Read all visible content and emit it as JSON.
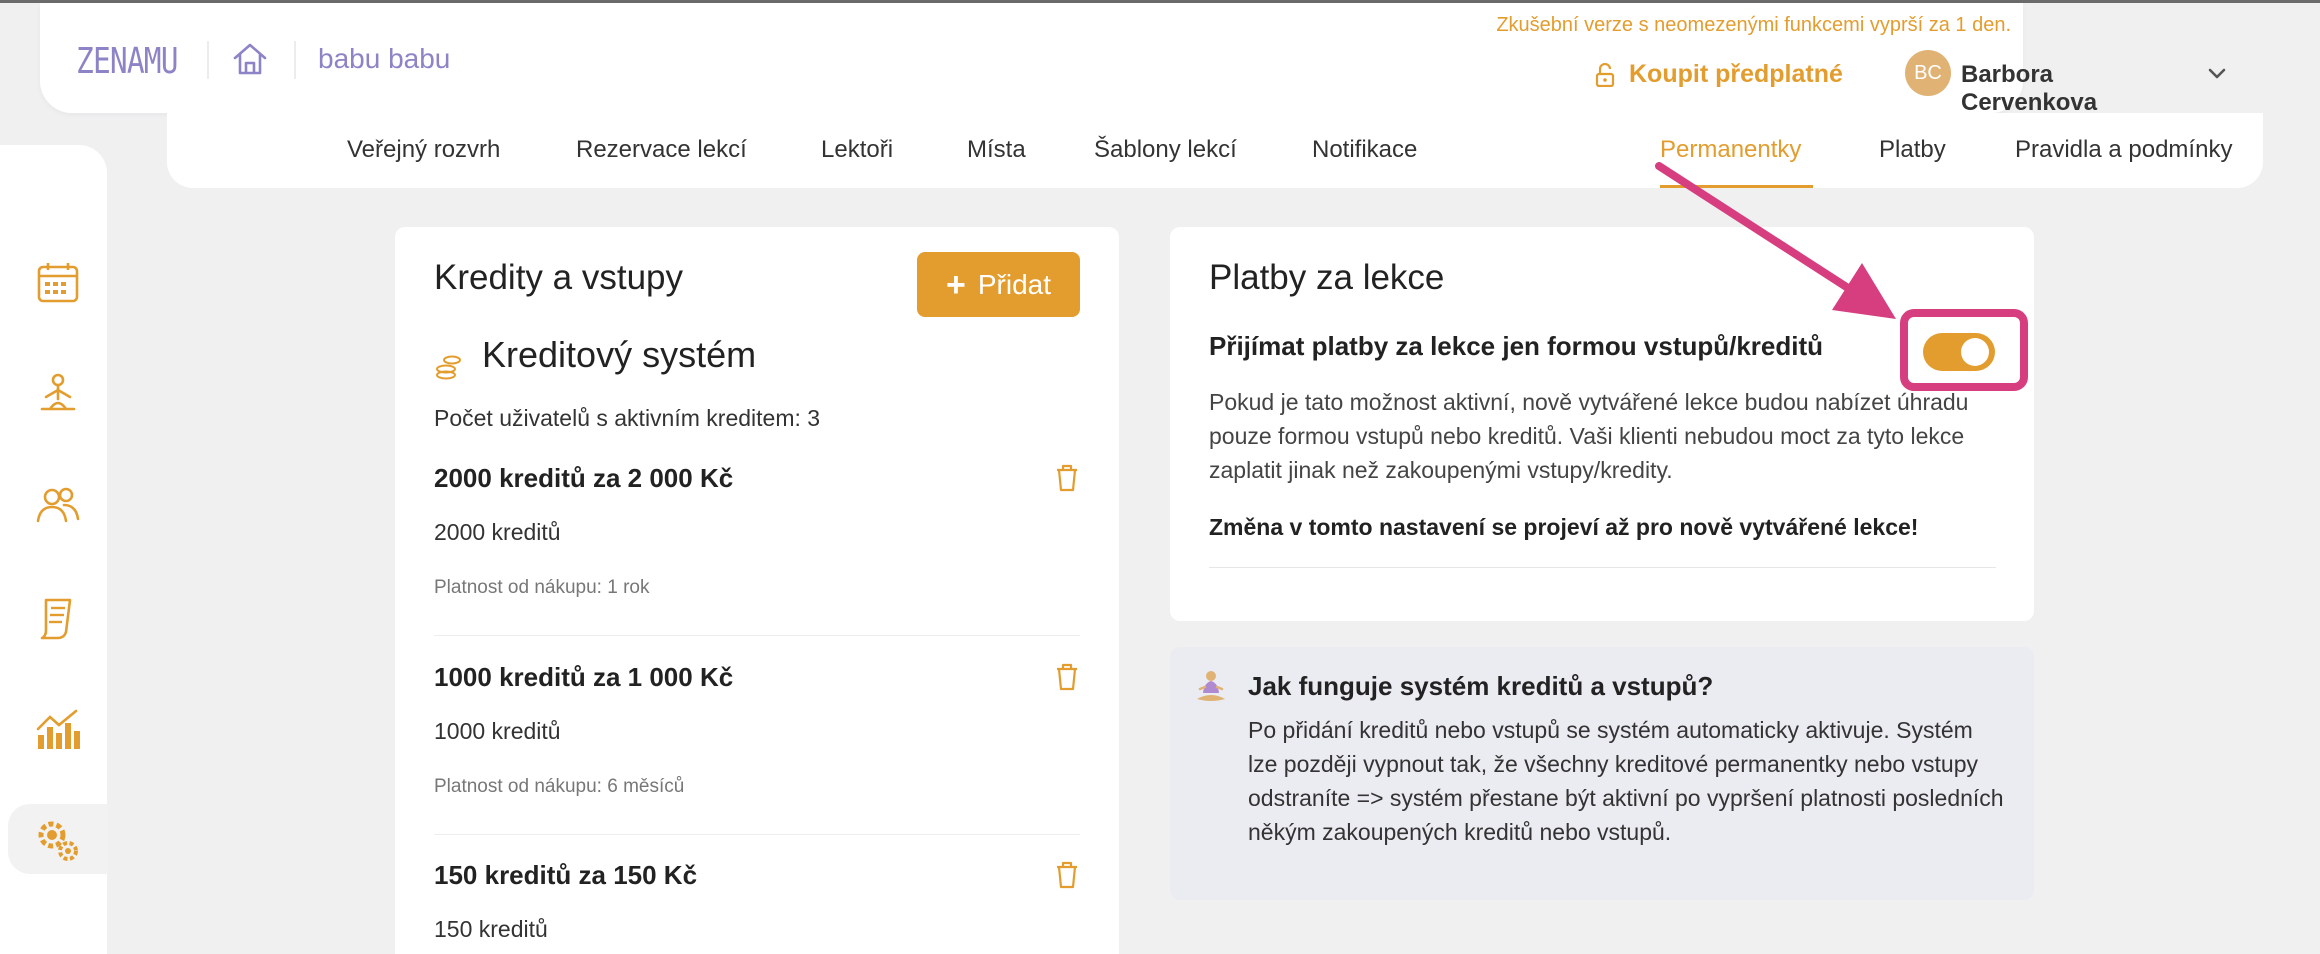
{
  "header": {
    "logo": "ZENAMU",
    "workspace_name": "babu babu",
    "trial_notice": "Zkušební verze s neomezenými funkcemi vyprší za 1 den.",
    "buy_label": "Koupit předplatné",
    "user_initials": "BC",
    "user_name": "Barbora Cervenkova"
  },
  "nav": {
    "items": [
      {
        "label": "Veřejný rozvrh"
      },
      {
        "label": "Rezervace lekcí"
      },
      {
        "label": "Lektoři"
      },
      {
        "label": "Místa"
      },
      {
        "label": "Šablony lekcí"
      },
      {
        "label": "Notifikace"
      },
      {
        "label": "Permanentky"
      },
      {
        "label": "Platby"
      },
      {
        "label": "Pravidla a podmínky"
      }
    ],
    "active": "Permanentky"
  },
  "sidebar": {
    "icons": [
      "calendar-icon",
      "yoga-icon",
      "users-icon",
      "document-icon",
      "chart-icon",
      "settings-icon"
    ],
    "active": "settings-icon"
  },
  "credits": {
    "title": "Kredity a vstupy",
    "add_label": "Přidat",
    "system_title": "Kreditový systém",
    "active_users_text": "Počet uživatelů s aktivním kreditem: 3",
    "items": [
      {
        "title": "2000 kreditů za 2 000 Kč",
        "credits": "2000 kreditů",
        "validity": "Platnost od nákupu: 1 rok"
      },
      {
        "title": "1000 kreditů za 1 000 Kč",
        "credits": "1000 kreditů",
        "validity": "Platnost od nákupu: 6 měsíců"
      },
      {
        "title": "150 kreditů za 150 Kč",
        "credits": "150 kreditů",
        "validity": ""
      }
    ]
  },
  "payments": {
    "title": "Platby za lekce",
    "toggle_label": "Přijímat platby za lekce jen formou vstupů/kreditů",
    "toggle_on": true,
    "description": "Pokud je tato možnost aktivní, nově vytvářené lekce budou nabízet úhradu pouze formou vstupů nebo kreditů. Vaši klienti nebudou moct za tyto lekce zaplatit jinak než zakoupenými vstupy/kredity.",
    "warning": "Změna v tomto nastavení se projeví až pro nově vytvářené lekce!"
  },
  "info": {
    "title": "Jak funguje systém kreditů a vstupů?",
    "body": "Po přidání kreditů nebo vstupů se systém automaticky aktivuje. Systém lze později vypnout tak, že všechny kreditové permanentky nebo vstupy odstraníte => systém přestane být aktivní po vypršení platnosti posledních někým zakoupených kreditů nebo vstupů."
  },
  "colors": {
    "accent": "#e39d2e",
    "brand": "#8c84c6",
    "annotation": "#d63e7f"
  }
}
